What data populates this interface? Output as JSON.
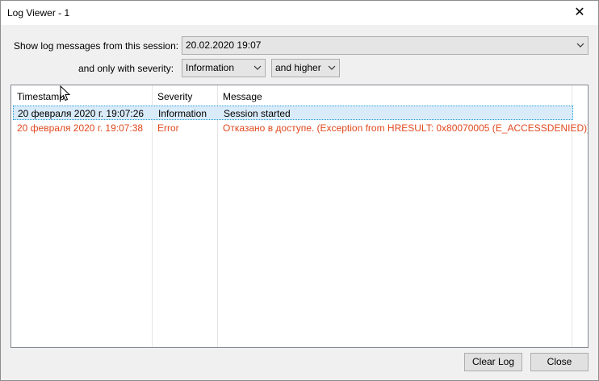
{
  "window": {
    "title": "Log Viewer - 1",
    "close_glyph": "✕"
  },
  "filters": {
    "session_label": "Show log messages from this session:",
    "session_value": "20.02.2020 19:07",
    "severity_label": "and only with severity:",
    "severity_value": "Information",
    "scope_value": "and higher"
  },
  "table": {
    "columns": [
      "Timestamp",
      "Severity",
      "Message"
    ],
    "rows": [
      {
        "timestamp": "20 февраля 2020 г. 19:07:26",
        "severity": "Information",
        "message": "Session started",
        "selected": true
      },
      {
        "timestamp": "20 февраля 2020 г. 19:07:38",
        "severity": "Error",
        "message": "Отказано в доступе. (Exception from HRESULT: 0x80070005 (E_ACCESSDENIED))",
        "selected": false
      }
    ]
  },
  "buttons": {
    "clear_log": "Clear Log",
    "close": "Close"
  },
  "colors": {
    "error_text": "#e0481e",
    "selection_bg": "#d9ebf9",
    "selection_border": "#26a0da"
  },
  "icons": [
    "close-icon",
    "chevron-down-icon",
    "mouse-cursor-icon"
  ]
}
